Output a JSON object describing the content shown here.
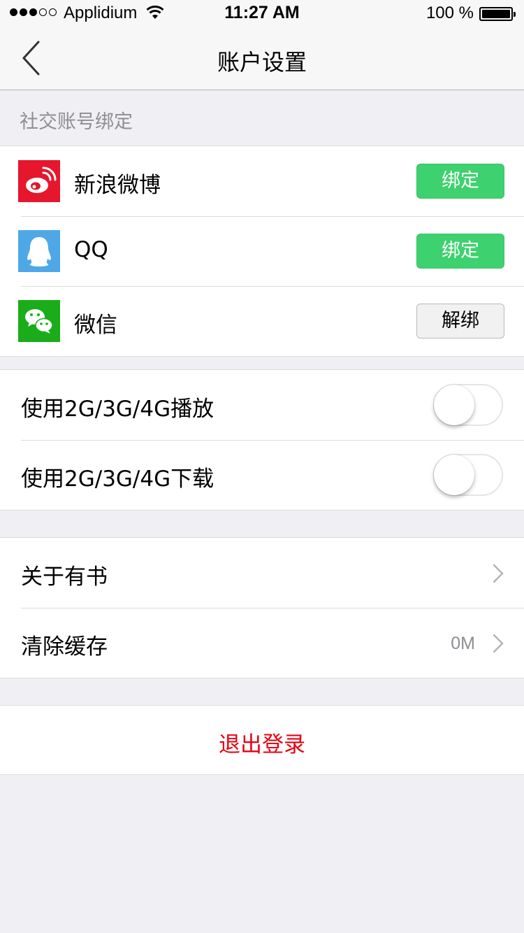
{
  "status_bar": {
    "carrier": "Applidium",
    "time": "11:27 AM",
    "battery_percent": "100 %",
    "signal_strength": 3,
    "signal_max": 5
  },
  "nav": {
    "title": "账户设置",
    "back_icon": "chevron-left-icon"
  },
  "social_section": {
    "header": "社交账号绑定",
    "accounts": [
      {
        "name": "新浪微博",
        "icon": "weibo-icon",
        "action": "绑定",
        "bound": false,
        "color": "#e6162d"
      },
      {
        "name": "QQ",
        "icon": "qq-icon",
        "action": "绑定",
        "bound": false,
        "color": "#4fa8e6"
      },
      {
        "name": "微信",
        "icon": "wechat-icon",
        "action": "解绑",
        "bound": true,
        "color": "#1aad19"
      }
    ]
  },
  "network_section": {
    "items": [
      {
        "label": "使用2G/3G/4G播放",
        "enabled": false
      },
      {
        "label": "使用2G/3G/4G下载",
        "enabled": false
      }
    ]
  },
  "misc_section": {
    "items": [
      {
        "label": "关于有书",
        "value": ""
      },
      {
        "label": "清除缓存",
        "value": "0M"
      }
    ]
  },
  "logout": {
    "label": "退出登录",
    "color": "#e60012"
  },
  "colors": {
    "bind_green": "#3ed16f",
    "background": "#efeff4"
  }
}
